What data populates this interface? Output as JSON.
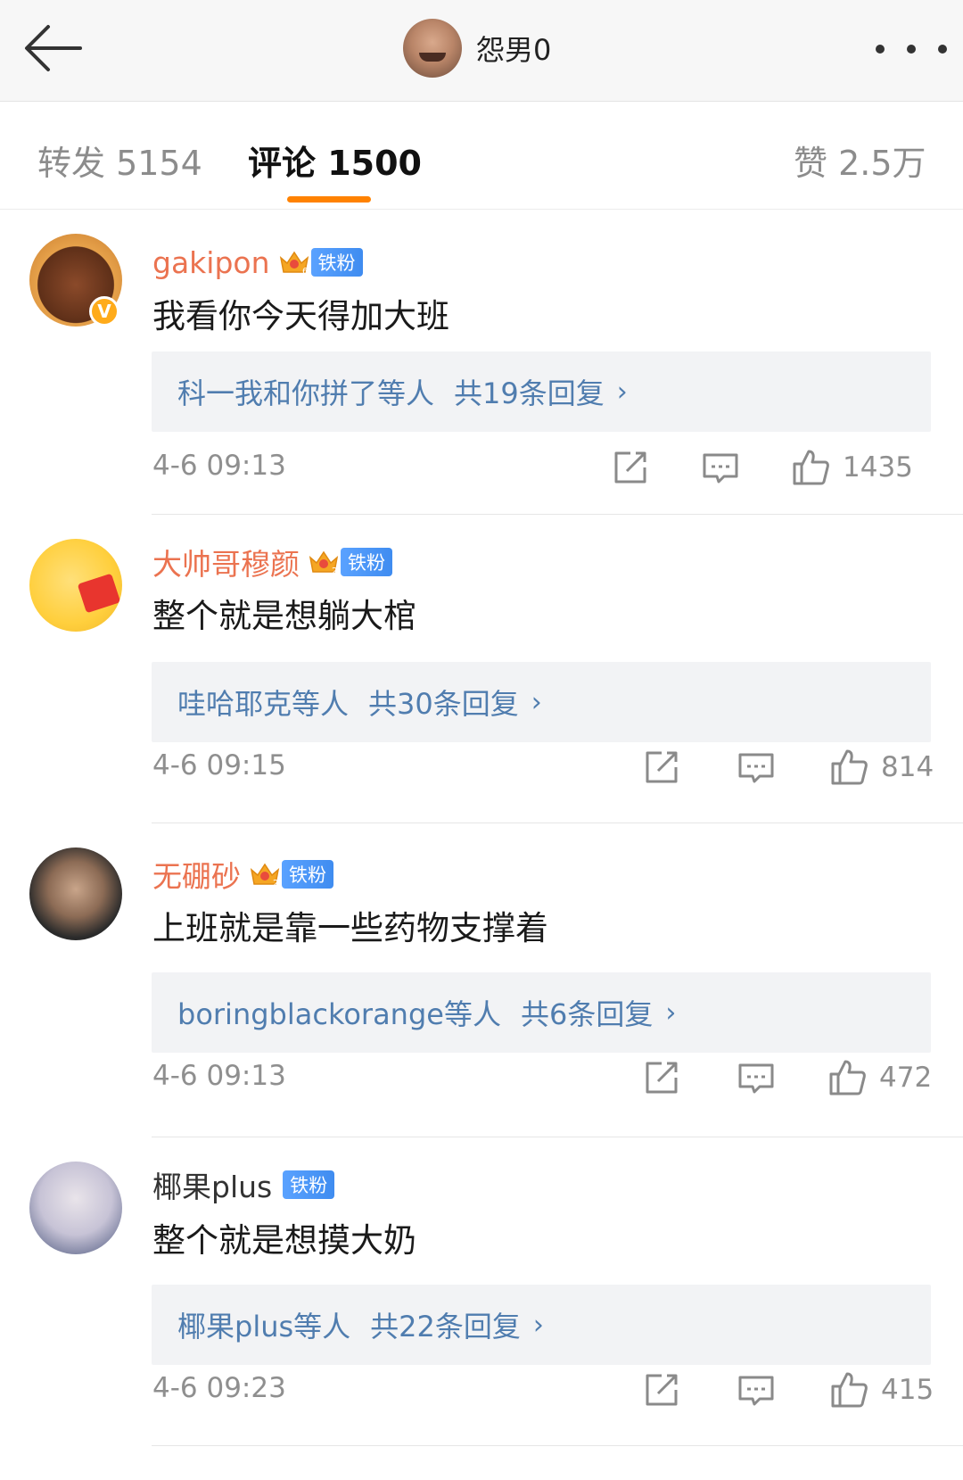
{
  "header": {
    "owner_name": "怨男0",
    "back_icon": "arrow-left-icon",
    "more_icon": "more-dots-icon"
  },
  "tabs": [
    {
      "label": "转发 5154"
    },
    {
      "label": "评论 1500"
    },
    {
      "label": "赞 2.5万"
    }
  ],
  "colors": {
    "accent": "#ff8200",
    "username": "#eb7350",
    "link": "#507daf",
    "fan_badge": "#4a95f7"
  },
  "comments": [
    {
      "username": "gakipon",
      "crown_num": "6",
      "fan_badge": "铁粉",
      "text": "我看你今天得加大班",
      "reply_names": "科一我和你拼了等人",
      "reply_count": "共19条回复",
      "time": "4-6 09:13",
      "likes": "1435",
      "verified": true
    },
    {
      "username": "大帅哥穆颜",
      "crown_num": "2",
      "fan_badge": "铁粉",
      "text": "整个就是想躺大棺",
      "reply_names": "哇哈耶克等人",
      "reply_count": "共30条回复",
      "time": "4-6 09:15",
      "likes": "814",
      "verified": false
    },
    {
      "username": "无硼砂",
      "crown_num": "2",
      "fan_badge": "铁粉",
      "text": "上班就是靠一些药物支撑着",
      "reply_names": "boringblackorange等人",
      "reply_count": "共6条回复",
      "time": "4-6 09:13",
      "likes": "472",
      "verified": false
    },
    {
      "username": "椰果plus",
      "crown_num": "",
      "fan_badge": "铁粉",
      "text": "整个就是想摸大奶",
      "reply_names": "椰果plus等人",
      "reply_count": "共22条回复",
      "time": "4-6 09:23",
      "likes": "415",
      "verified": false
    }
  ],
  "verified_badge_text": "V",
  "arrow_glyph": "›"
}
